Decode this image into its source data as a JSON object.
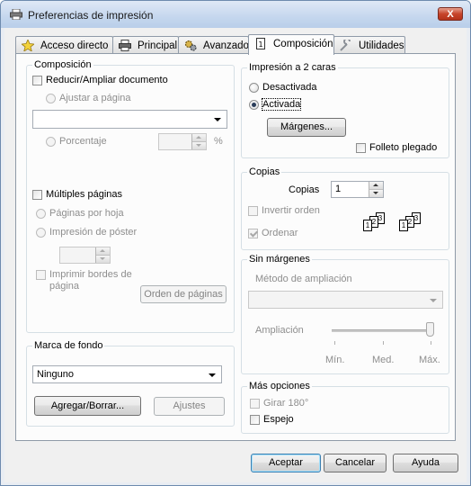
{
  "window": {
    "title": "Preferencias de impresión",
    "close_label": "X"
  },
  "tabs": [
    {
      "label": "Acceso directo",
      "icon": "star-icon"
    },
    {
      "label": "Principal",
      "icon": "printer-icon"
    },
    {
      "label": "Avanzado",
      "icon": "gears-icon"
    },
    {
      "label": "Composición",
      "icon": "page-layout-icon",
      "active": true
    },
    {
      "label": "Utilidades",
      "icon": "wrench-icon"
    }
  ],
  "composition": {
    "title": "Composición",
    "reduce_enlarge": "Reducir/Ampliar documento",
    "fit_to_page": "Ajustar a página",
    "fit_value": "",
    "percentage": "Porcentaje",
    "percent_value": "",
    "percent_unit": "%",
    "multiple_pages": "Múltiples páginas",
    "pages_per_sheet": "Páginas por hoja",
    "poster_print": "Impresión de póster",
    "poster_value": "",
    "print_page_borders": "Imprimir bordes de página",
    "page_order_button": "Orden de páginas"
  },
  "watermark": {
    "title": "Marca de fondo",
    "selected": "Ninguno",
    "add_delete_button": "Agregar/Borrar...",
    "settings_button": "Ajustes"
  },
  "duplex": {
    "title": "Impresión a 2 caras",
    "off": "Desactivada",
    "on": "Activada",
    "selected": "Activada",
    "margins_button": "Márgenes...",
    "booklet": "Folleto plegado"
  },
  "copies": {
    "title": "Copias",
    "copies_label": "Copias",
    "copies_value": "1",
    "reverse_order": "Invertir orden",
    "collate": "Ordenar",
    "collate_checked": true,
    "collate_page_numbers": [
      "1",
      "2",
      "3"
    ]
  },
  "borderless": {
    "title": "Sin márgenes",
    "enlargement_method": "Método de ampliación",
    "method_value": "",
    "enlargement": "Ampliación",
    "slider_level": 1.0,
    "scale_labels": [
      "Mín.",
      "Med.",
      "Máx."
    ]
  },
  "more_options": {
    "title": "Más opciones",
    "rotate": "Girar 180°",
    "mirror": "Espejo"
  },
  "footer": {
    "ok_button": "Aceptar",
    "cancel_button": "Cancelar",
    "help_button": "Ayuda"
  }
}
